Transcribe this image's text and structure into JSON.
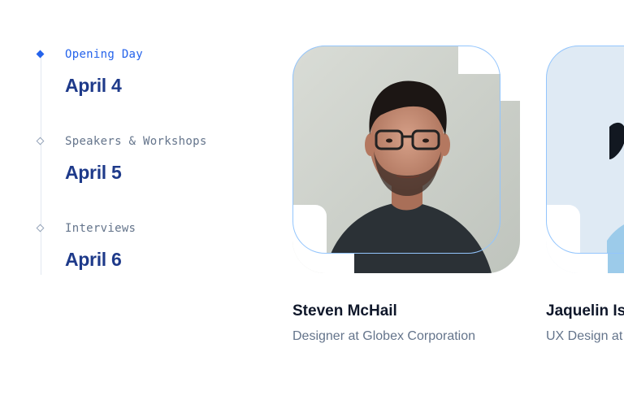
{
  "timeline": {
    "items": [
      {
        "label": "Opening Day",
        "date": "April 4",
        "active": true
      },
      {
        "label": "Speakers & Workshops",
        "date": "April 5",
        "active": false
      },
      {
        "label": "Interviews",
        "date": "April 6",
        "active": false
      }
    ]
  },
  "speakers": [
    {
      "name": "Steven McHail",
      "role": "Designer at Globex Corporation"
    },
    {
      "name": "Jaquelin Isa",
      "role": "UX Design at"
    }
  ],
  "colors": {
    "accent": "#2563eb",
    "date_text": "#1e3a8a",
    "muted_text": "#64748b",
    "outline": "#93c5fd"
  }
}
